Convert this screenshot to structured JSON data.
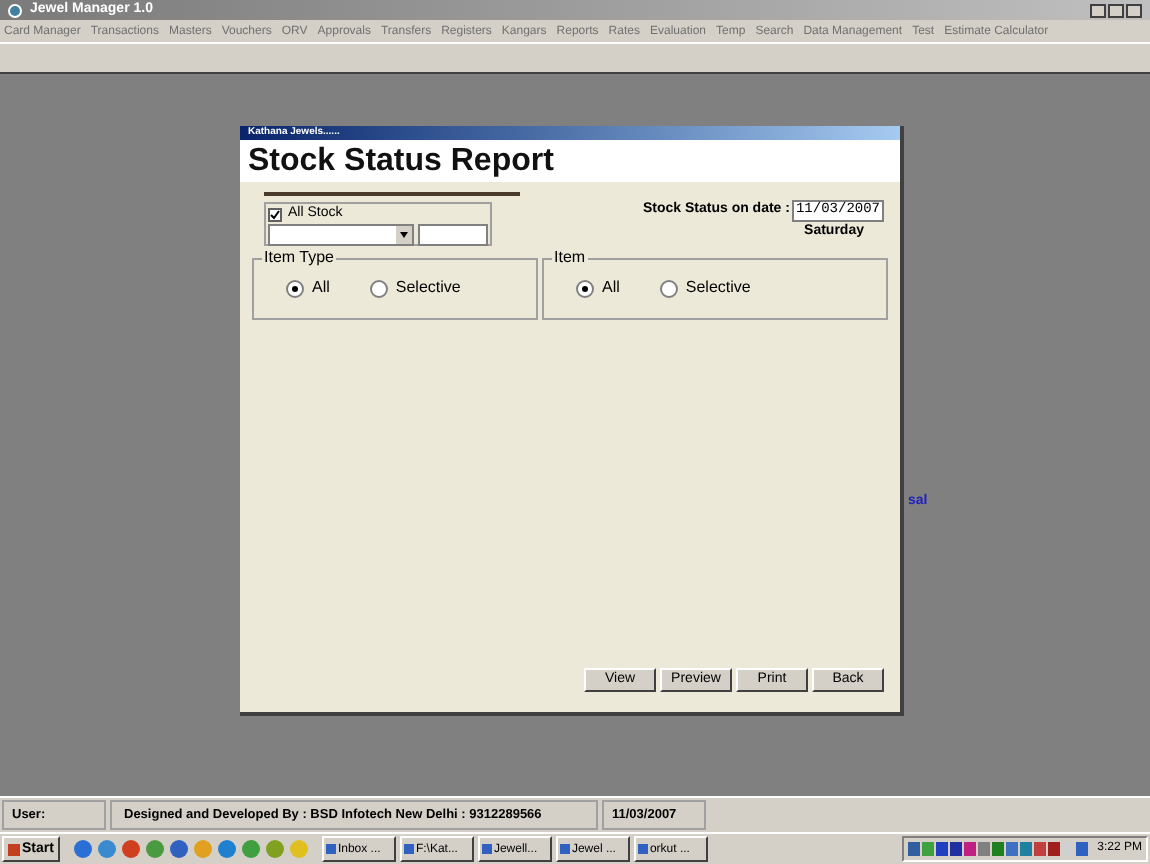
{
  "window": {
    "title": "Jewel Manager 1.0"
  },
  "menu": [
    "Card Manager",
    "Transactions",
    "Masters",
    "Vouchers",
    "ORV",
    "Approvals",
    "Transfers",
    "Registers",
    "Kangars",
    "Reports",
    "Rates",
    "Evaluation",
    "Temp",
    "Search",
    "Data Management",
    "Test",
    "Estimate Calculator"
  ],
  "background_text": "sal",
  "dialog": {
    "caption": "Kathana Jewels......",
    "title": "Stock Status Report",
    "all_stock": {
      "label": "All Stock",
      "checked": true
    },
    "date_label": "Stock Status on date :",
    "date_value": "11/03/2007",
    "weekday": "Saturday",
    "groups": [
      {
        "title": "Item Type",
        "options": [
          {
            "label": "All",
            "selected": true
          },
          {
            "label": "Selective",
            "selected": false
          }
        ]
      },
      {
        "title": "Item",
        "options": [
          {
            "label": "All",
            "selected": true
          },
          {
            "label": "Selective",
            "selected": false
          }
        ]
      }
    ],
    "buttons": [
      "View",
      "Preview",
      "Print",
      "Back"
    ]
  },
  "status_bar": {
    "user": "User:",
    "credit": "Designed and Developed By : BSD Infotech New Delhi : 9312289566",
    "date": "11/03/2007"
  },
  "taskbar": {
    "start": "Start",
    "tasks": [
      "Inbox ...",
      "F:\\Kat...",
      "Jewell...",
      "Jewel ...",
      "orkut ..."
    ],
    "clock": "3:22 PM"
  }
}
